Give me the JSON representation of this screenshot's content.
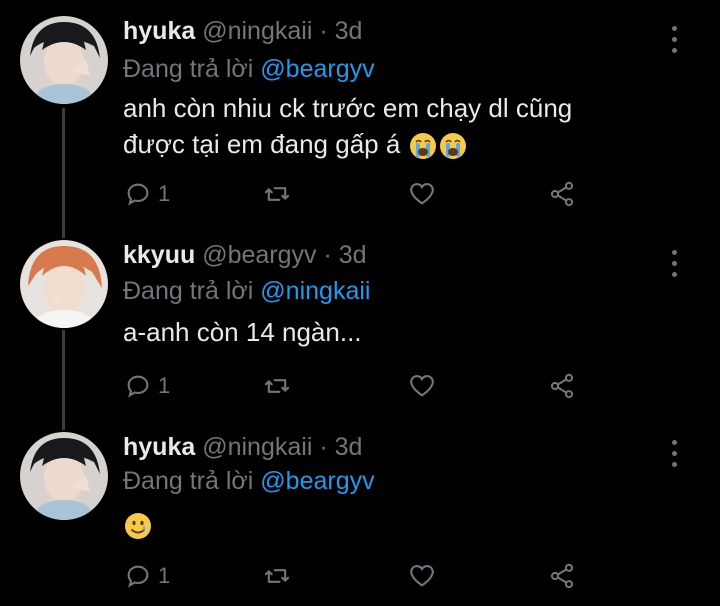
{
  "tweets": [
    {
      "display_name": "hyuka",
      "handle": "@ningkaii",
      "separator": "·",
      "time": "3d",
      "replying_prefix": "Đang trả lời",
      "replying_to": "@beargyv",
      "text_line1": "anh còn nhiu ck trước em chạy dl cũng",
      "text_line2": "được tại em đang gấp á",
      "emoji": [
        "loudly-crying-face",
        "loudly-crying-face"
      ],
      "reply_count": "1"
    },
    {
      "display_name": "kkyuu",
      "handle": "@beargyv",
      "separator": "·",
      "time": "3d",
      "replying_prefix": "Đang trả lời",
      "replying_to": "@ningkaii",
      "text_line1": "a-anh còn 14 ngàn...",
      "reply_count": "1"
    },
    {
      "display_name": "hyuka",
      "handle": "@ningkaii",
      "separator": "·",
      "time": "3d",
      "replying_prefix": "Đang trả lời",
      "replying_to": "@beargyv",
      "emoji": [
        "smiling-face-with-tear"
      ],
      "reply_count": "1"
    }
  ],
  "colors": {
    "background": "#000000",
    "text": "#e7e9ea",
    "muted": "#71767b",
    "mention": "#1d9bf0",
    "thread_line": "#3b3f44"
  },
  "icons": [
    "reply-icon",
    "retweet-icon",
    "like-icon",
    "share-icon",
    "more-options-icon"
  ]
}
